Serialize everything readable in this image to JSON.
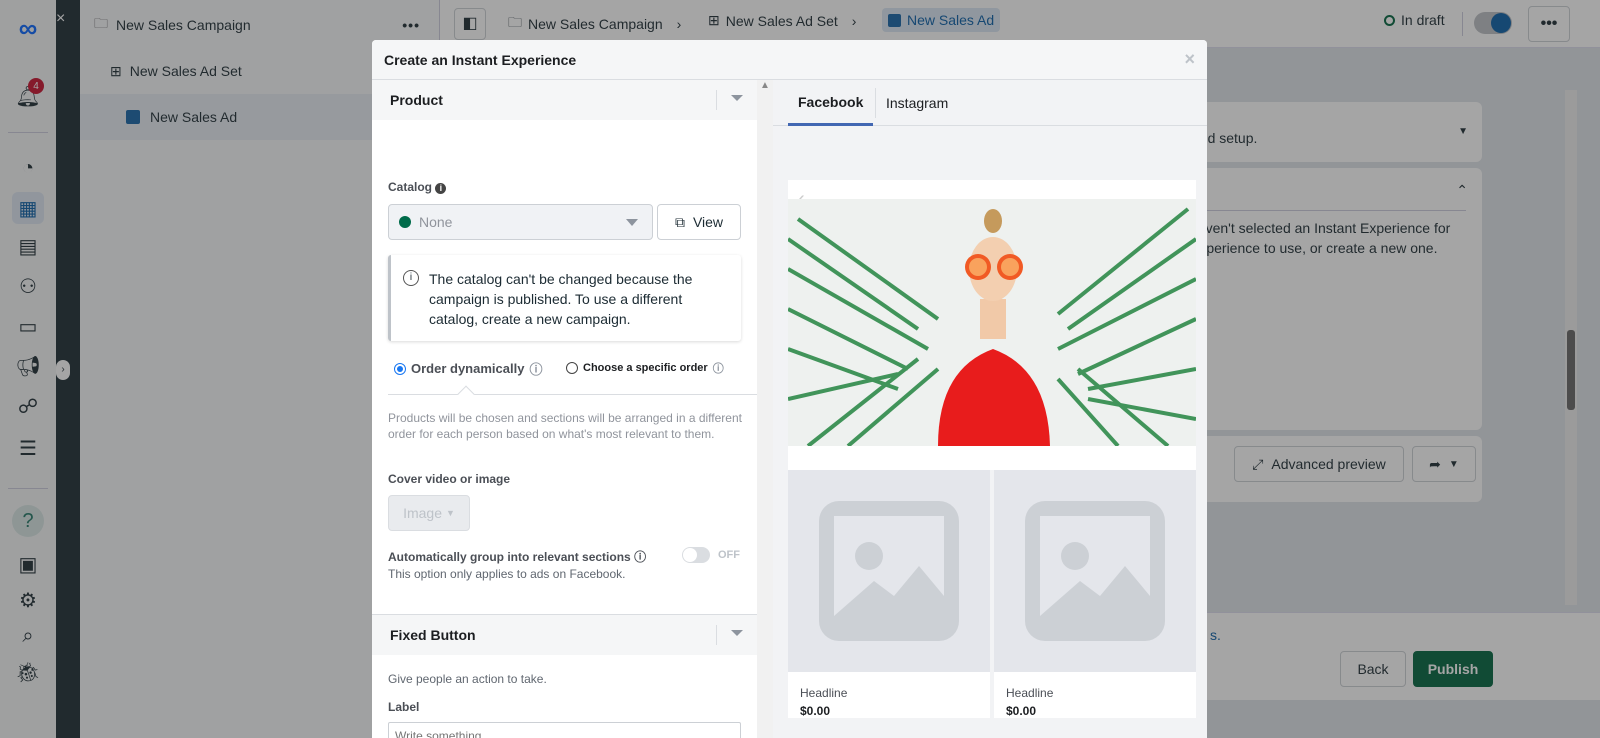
{
  "rail": {
    "notification_count": "4"
  },
  "tree": {
    "campaign": "New Sales Campaign",
    "ad_set": "New Sales Ad Set",
    "ad": "New Sales Ad",
    "more": "•••"
  },
  "topbar": {
    "breadcrumbs": [
      "New Sales Campaign",
      "New Sales Ad Set",
      "New Sales Ad"
    ],
    "status": "In draft",
    "more": "•••"
  },
  "main": {
    "card1_text": "ded setup.",
    "card2_text_1": "haven't selected an Instant Experience for",
    "card2_text_2": "Experience to use, or create a new one.",
    "advanced_preview": "Advanced preview"
  },
  "footer": {
    "link_fragment": "s.",
    "back": "Back",
    "publish": "Publish"
  },
  "modal": {
    "title": "Create an Instant Experience",
    "close": "×",
    "product": {
      "header": "Product",
      "catalog_label": "Catalog",
      "catalog_value": "None",
      "view_button": "View",
      "notice": "The catalog can't be changed because the campaign is published. To use a different catalog, create a new campaign.",
      "order_options": [
        {
          "label": "Order dynamically",
          "selected": true
        },
        {
          "label": "Choose a specific order",
          "selected": false
        }
      ],
      "order_description": "Products will be chosen and sections will be arranged in a different order for each person based on what's most relevant to them.",
      "cover_label": "Cover video or image",
      "cover_value": "Image",
      "auto_group_label": "Automatically group into relevant sections",
      "auto_group_state": "OFF",
      "auto_group_note": "This option only applies to ads on Facebook."
    },
    "fixed_button": {
      "header": "Fixed Button",
      "description": "Give people an action to take.",
      "label": "Label",
      "placeholder": "Write something..."
    },
    "preview": {
      "tabs": [
        "Facebook",
        "Instagram"
      ],
      "active_tab": "Facebook",
      "products": [
        {
          "headline": "Headline",
          "price": "$0.00"
        },
        {
          "headline": "Headline",
          "price": "$0.00"
        }
      ]
    }
  },
  "colors": {
    "accent": "#1877f2",
    "publish": "#00643f",
    "catalog_dot": "#006b4a",
    "badge": "#c8102e"
  }
}
